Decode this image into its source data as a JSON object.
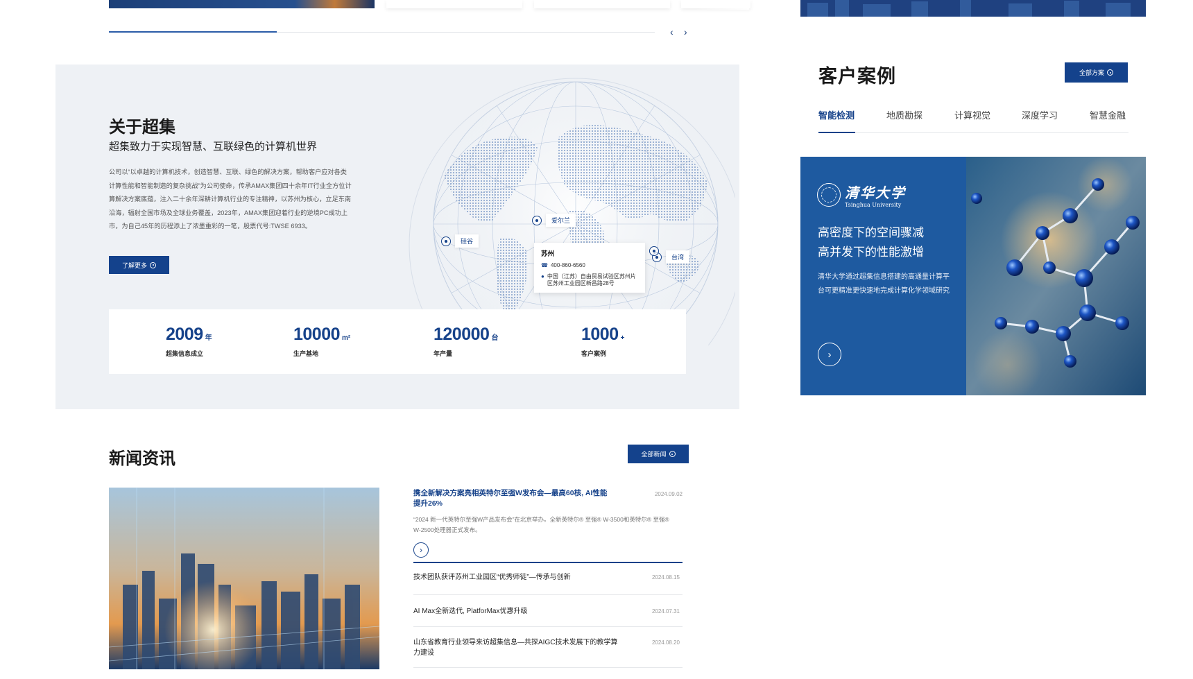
{
  "colors": {
    "brand": "#16428a",
    "section_bg": "#eef1f5"
  },
  "slider": {
    "prev_icon": "‹",
    "next_icon": "›"
  },
  "about": {
    "title": "关于超集",
    "subtitle": "超集致力于实现智慧、互联绿色的计算机世界",
    "body": "公司以“以卓越的计算机技术，创造智慧、互联、绿色的解决方案，帮助客户应对各类计算性能和智能制造的复杂挑战”为公司使命，传承AMAX集团四十余年IT行业全方位计算解决方案底蕴，注入二十余年深耕计算机行业的专注精神，以苏州为核心，立足东南沿海，辐射全国市场及全球业务覆盖，2023年，AMAX集团迎着行业的逆境PC成功上市，为自己45年的历程添上了浓墨重彩的一笔，股票代号:TWSE 6933。",
    "button_label": "了解更多",
    "stats": [
      {
        "num": "2009",
        "unit": "年",
        "label": "超集信息成立"
      },
      {
        "num": "10000",
        "unit": "m²",
        "label": "生产基地"
      },
      {
        "num": "120000",
        "unit": "台",
        "label": "年产量"
      },
      {
        "num": "1000",
        "unit": "+",
        "label": "客户案例"
      }
    ],
    "map": {
      "pins": [
        {
          "label": "硅谷"
        },
        {
          "label": "爱尔兰"
        },
        {
          "label": "台湾"
        }
      ],
      "popup": {
        "city": "苏州",
        "phone": "400-860-6560",
        "address": "中国（江苏）自由贸易试验区苏州片区苏州工业园区新昌路28号"
      }
    }
  },
  "news": {
    "title": "新闻资讯",
    "button_label": "全部新闻",
    "feature": {
      "title": "携全新解决方案亮相英特尔至强W发布会—最高60核, AI性能提升26%",
      "date": "2024.09.02",
      "desc": "“2024 新一代英特尔至强W产品发布会”在北京举办。全新英特尔® 至强® W-3500和英特尔® 至强® W-2500处理器正式发布。"
    },
    "items": [
      {
        "title": "技术团队获评苏州工业园区“优秀师徒”—传承与创新",
        "date": "2024.08.15"
      },
      {
        "title": "AI Max全新迭代, PlatforMax优惠升级",
        "date": "2024.07.31"
      },
      {
        "title": "山东省教育行业领导来访超集信息—共探AIGC技术发展下的教学算力建设",
        "date": "2024.08.20"
      }
    ]
  },
  "cases": {
    "title": "客户案例",
    "button_label": "全部方案",
    "tabs": [
      "智能检测",
      "地质勘探",
      "计算视觉",
      "深度学习",
      "智慧金融"
    ],
    "card": {
      "logo_cn": "清华大学",
      "logo_en": "Tsinghua University",
      "headline_1": "高密度下的空间骤减",
      "headline_2": "高并发下的性能激增",
      "desc": "清华大学通过超集信息搭建的高通量计算平台可更精准更快速地完成计算化学领域研究"
    }
  }
}
